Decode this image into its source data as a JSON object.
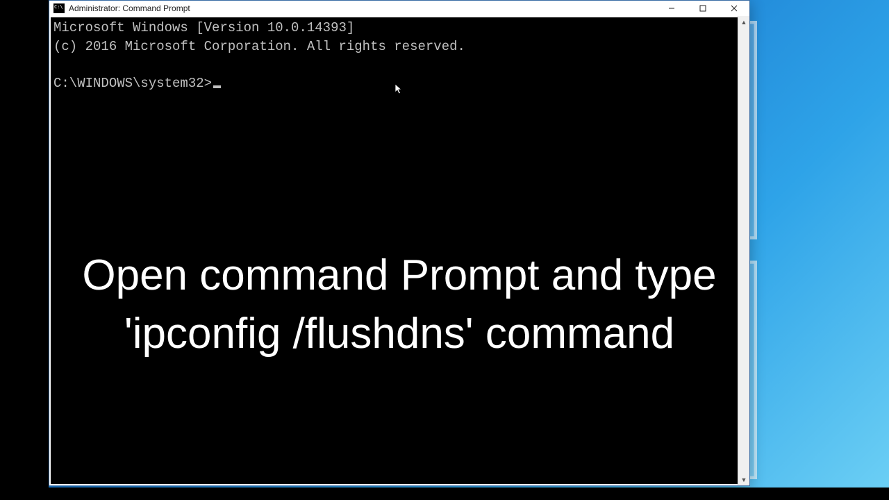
{
  "window": {
    "title": "Administrator: Command Prompt"
  },
  "console": {
    "line1": "Microsoft Windows [Version 10.0.14393]",
    "line2": "(c) 2016 Microsoft Corporation. All rights reserved.",
    "blank": "",
    "prompt": "C:\\WINDOWS\\system32>"
  },
  "caption": "Open command Prompt and type 'ipconfig /flushdns' command",
  "scrollbar": {
    "up": "▲",
    "down": "▼"
  }
}
